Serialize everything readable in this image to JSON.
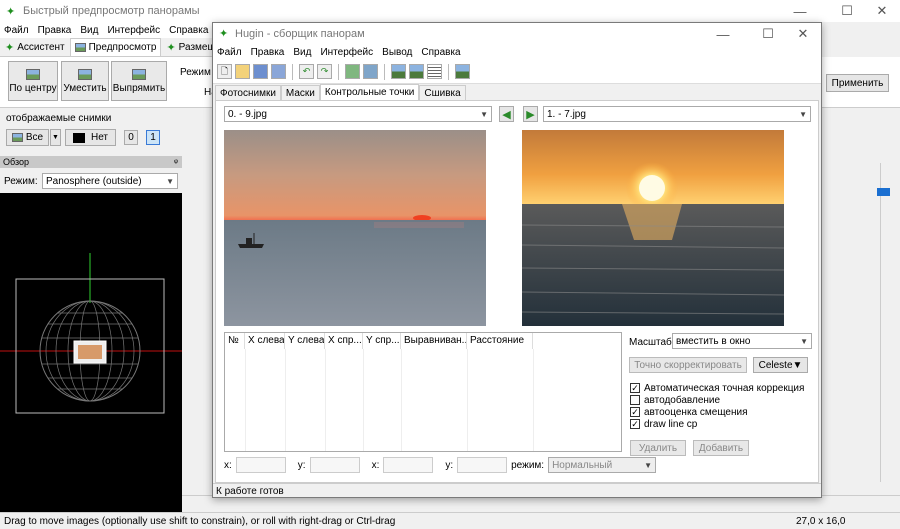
{
  "back_window": {
    "title": "Быстрый предпросмотр панорамы",
    "menu": [
      "Файл",
      "Правка",
      "Вид",
      "Интерфейс",
      "Справка"
    ],
    "tabs": [
      "Ассистент",
      "Предпросмотр",
      "Размещение"
    ],
    "toolbar": {
      "center_label": "По центру",
      "fit_label": "Уместить",
      "straighten_label": "Выпрямить",
      "mode_label": "Режим п",
      "na_label": "На",
      "apply_label": "Применить"
    },
    "shown_images": {
      "label": "отображаемые снимки",
      "all_label": "Все",
      "none_label": "Нет",
      "img0": "0",
      "img1": "1"
    },
    "overview": {
      "title": "Обзор",
      "pin": "ᵠ",
      "mode_label": "Режим:",
      "mode_value": "Panosphere (outside)"
    },
    "status": {
      "hint": "Drag to move images (optionally use shift to constrain), or roll with right-drag or Ctrl-drag",
      "fov": "27,0 x 16,0"
    }
  },
  "hugin": {
    "title": "Hugin - сборщик панорам",
    "menu": [
      "Файл",
      "Правка",
      "Вид",
      "Интерфейс",
      "Вывод",
      "Справка"
    ],
    "tabs": [
      "Фотоснимки",
      "Маски",
      "Контрольные точки",
      "Сшивка"
    ],
    "left_image": "0. - 9.jpg",
    "right_image": "1. - 7.jpg",
    "table_columns": [
      "№",
      "X слева",
      "Y слева",
      "X спр...",
      "Y спр...",
      "Выравниван...",
      "Расстояние"
    ],
    "scale_label": "Масштаб:",
    "scale_value": "вместить в окно",
    "fine_tune_label": "Точно скорректировать",
    "detector_label": "Celeste▼",
    "checkboxes": [
      {
        "label": "Автоматическая точная коррекция",
        "checked": true
      },
      {
        "label": "автодобавление",
        "checked": false
      },
      {
        "label": "автооценка смещения",
        "checked": true
      },
      {
        "label": "draw line cp",
        "checked": true
      }
    ],
    "delete_label": "Удалить",
    "add_label": "Добавить",
    "coords": {
      "x1": "x:",
      "y1": "y:",
      "x2": "x:",
      "y2": "y:",
      "mode_label": "режим:",
      "mode_value": "Нормальный"
    },
    "status": "К работе готов"
  },
  "colors": {
    "accent": "#3a7ad6",
    "grid_green": "#2fd12f",
    "axis_red": "#c01010"
  }
}
